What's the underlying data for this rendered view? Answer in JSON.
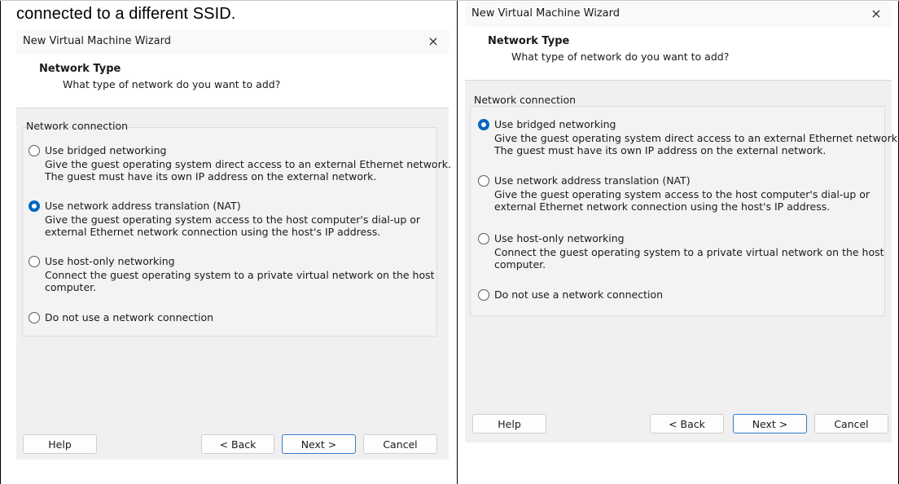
{
  "caption": "connected to a different SSID.",
  "dialogs": {
    "left": {
      "title": "New Virtual Machine Wizard",
      "close": "×",
      "header_title": "Network Type",
      "header_subtitle": "What type of network do you want to add?",
      "group_label": "Network connection",
      "selected": "nat",
      "options": [
        {
          "label": "Use bridged networking",
          "desc": "Give the guest operating system direct access to an external Ethernet network.\nThe guest must have its own IP address on the external network."
        },
        {
          "label": "Use network address translation (NAT)",
          "desc": "Give the guest operating system access to the host computer's dial-up or\nexternal Ethernet network connection using the host's IP address."
        },
        {
          "label": "Use host-only networking",
          "desc": "Connect the guest operating system to a private virtual network on the host\ncomputer."
        },
        {
          "label": "Do not use a network connection",
          "desc": ""
        }
      ],
      "buttons": {
        "help": "Help",
        "back": "< Back",
        "next": "Next >",
        "cancel": "Cancel"
      }
    },
    "right": {
      "title": "New Virtual Machine Wizard",
      "close": "×",
      "header_title": "Network Type",
      "header_subtitle": "What type of network do you want to add?",
      "group_label": "Network connection",
      "selected": "bridged",
      "options": [
        {
          "label": "Use bridged networking",
          "desc": "Give the guest operating system direct access to an external Ethernet network.\nThe guest must have its own IP address on the external network."
        },
        {
          "label": "Use network address translation (NAT)",
          "desc": "Give the guest operating system access to the host computer's dial-up or\nexternal Ethernet network connection using the host's IP address."
        },
        {
          "label": "Use host-only networking",
          "desc": "Connect the guest operating system to a private virtual network on the host\ncomputer."
        },
        {
          "label": "Do not use a network connection",
          "desc": ""
        }
      ],
      "buttons": {
        "help": "Help",
        "back": "< Back",
        "next": "Next >",
        "cancel": "Cancel"
      }
    }
  },
  "colors": {
    "accent": "#0067c0",
    "dialog_bg": "#f0f0f0",
    "primary_border": "#2f7fd0"
  }
}
